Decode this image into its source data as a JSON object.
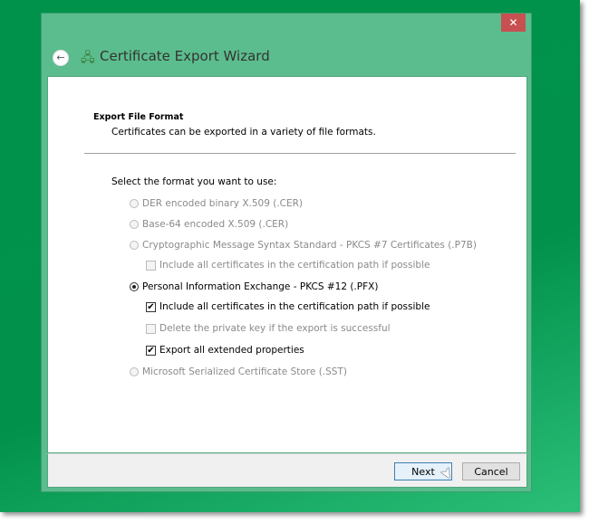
{
  "window": {
    "title": "Certificate Export Wizard",
    "close": "✕",
    "back": "←",
    "app_icon": "🖧"
  },
  "header": {
    "title": "Export File Format",
    "subtitle": "Certificates can be exported in a variety of file formats."
  },
  "prompt": "Select the format you want to use:",
  "options": [
    {
      "label": "DER encoded binary X.509 (.CER)",
      "selected": false,
      "enabled": false
    },
    {
      "label": "Base-64 encoded X.509 (.CER)",
      "selected": false,
      "enabled": false
    },
    {
      "label": "Cryptographic Message Syntax Standard - PKCS #7 Certificates (.P7B)",
      "selected": false,
      "enabled": false
    },
    {
      "label": "Personal Information Exchange - PKCS #12 (.PFX)",
      "selected": true,
      "enabled": true
    },
    {
      "label": "Microsoft Serialized Certificate Store (.SST)",
      "selected": false,
      "enabled": false
    }
  ],
  "checkboxes": [
    {
      "label": "Include all certificates in the certification path if possible",
      "checked": false,
      "enabled": false,
      "check": ""
    },
    {
      "label": "Include all certificates in the certification path if possible",
      "checked": true,
      "enabled": true,
      "check": "✔"
    },
    {
      "label": "Delete the private key if the export is successful",
      "checked": false,
      "enabled": false,
      "check": ""
    },
    {
      "label": "Export all extended properties",
      "checked": true,
      "enabled": true,
      "check": "✔"
    }
  ],
  "buttons": {
    "next": "Next",
    "cancel": "Cancel"
  },
  "cursor": "➤"
}
